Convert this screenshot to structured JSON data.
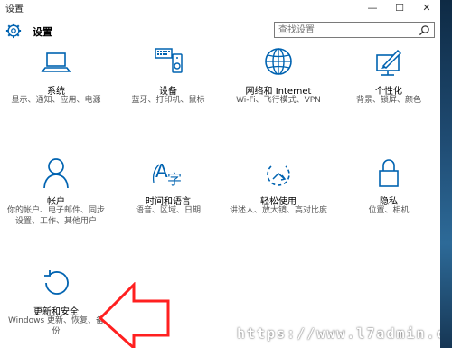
{
  "window": {
    "title": "设置",
    "controls": [
      "—",
      "☐",
      "✕"
    ]
  },
  "header": {
    "title": "设置",
    "search_placeholder": "查找设置"
  },
  "tiles": [
    {
      "label": "系统",
      "desc": "显示、通知、应用、电源",
      "icon": "laptop-icon"
    },
    {
      "label": "设备",
      "desc": "蓝牙、打印机、鼠标",
      "icon": "devices-icon"
    },
    {
      "label": "网络和 Internet",
      "desc": "Wi-Fi、飞行模式、VPN",
      "icon": "globe-icon"
    },
    {
      "label": "个性化",
      "desc": "背景、锁屏、颜色",
      "icon": "personalization-icon"
    },
    {
      "label": "帐户",
      "desc": "你的帐户、电子邮件、同步设置、工作、其他用户",
      "icon": "person-icon"
    },
    {
      "label": "时间和语言",
      "desc": "语音、区域、日期",
      "icon": "time-language-icon"
    },
    {
      "label": "轻松使用",
      "desc": "讲述人、放大镜、高对比度",
      "icon": "ease-of-access-icon"
    },
    {
      "label": "隐私",
      "desc": "位置、相机",
      "icon": "lock-icon"
    },
    {
      "label": "更新和安全",
      "desc": "Windows 更新、恢复、备份",
      "icon": "update-icon"
    }
  ],
  "watermark": "https://www.l7admin.cc",
  "colors": {
    "accent": "#0063b1",
    "arrow": "#ff2020"
  }
}
